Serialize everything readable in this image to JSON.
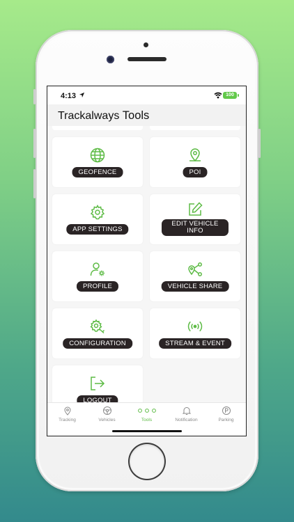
{
  "status": {
    "time": "4:13",
    "battery": "100"
  },
  "header": {
    "title_main": "Trackalways",
    "title_section": "Tools"
  },
  "tiles": [
    {
      "label": "GEOFENCE",
      "icon": "globe-icon"
    },
    {
      "label": "POI",
      "icon": "map-pin-icon"
    },
    {
      "label": "APP SETTINGS",
      "icon": "gear-icon"
    },
    {
      "label": "EDIT VEHICLE INFO",
      "icon": "edit-icon"
    },
    {
      "label": "PROFILE",
      "icon": "user-settings-icon"
    },
    {
      "label": "VEHICLE SHARE",
      "icon": "location-share-icon"
    },
    {
      "label": "CONFIGURATION",
      "icon": "config-gear-icon"
    },
    {
      "label": "STREAM & EVENT",
      "icon": "broadcast-icon"
    },
    {
      "label": "LOGOUT",
      "icon": "logout-icon"
    }
  ],
  "tabs": [
    {
      "label": "Tracking",
      "icon": "location-pin-icon"
    },
    {
      "label": "Vehicles",
      "icon": "steering-wheel-icon"
    },
    {
      "label": "Tools",
      "icon": "dots-icon",
      "active": true
    },
    {
      "label": "Notification",
      "icon": "bell-icon"
    },
    {
      "label": "Parking",
      "icon": "parking-icon"
    }
  ],
  "colors": {
    "accent": "#5dbb45",
    "pill_bg": "#2a2425"
  }
}
